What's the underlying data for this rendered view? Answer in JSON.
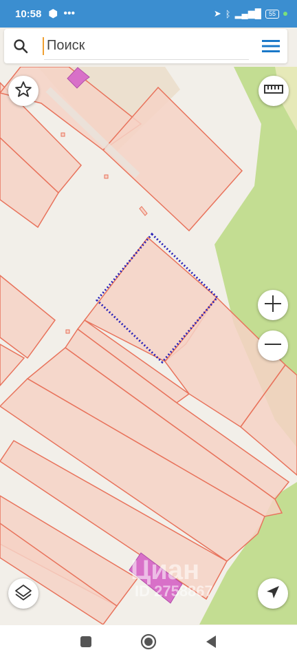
{
  "status": {
    "time": "10:58",
    "battery": "55"
  },
  "search": {
    "placeholder": "Поиск"
  },
  "watermark": {
    "brand": "Циан",
    "id": "ID 2758867"
  },
  "colors": {
    "statusbar": "#3b8ed0",
    "accent": "#1a78c8",
    "parcel_fill": "#f6d2c6",
    "parcel_stroke": "#e8735c",
    "green_area": "#c3dd92",
    "building": "#d870c8",
    "selection": "#2a22b8"
  },
  "icons": [
    "search-icon",
    "menu-icon",
    "star-icon",
    "ruler-icon",
    "zoom-in-icon",
    "zoom-out-icon",
    "layers-icon",
    "locate-icon",
    "recents-icon",
    "home-icon",
    "back-icon"
  ]
}
